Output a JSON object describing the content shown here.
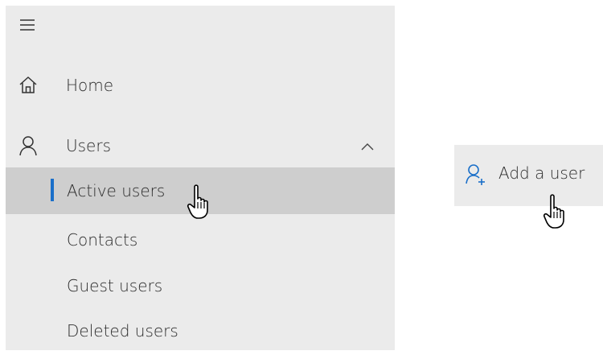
{
  "nav": {
    "menu_icon": "hamburger-icon",
    "items": [
      {
        "label": "Home",
        "icon": "home-icon"
      },
      {
        "label": "Users",
        "icon": "person-icon",
        "expanded": true,
        "chevron": "chevron-up-icon"
      }
    ],
    "users_submenu": [
      {
        "label": "Active users",
        "selected": true
      },
      {
        "label": "Contacts"
      },
      {
        "label": "Guest users"
      },
      {
        "label": "Deleted users"
      }
    ]
  },
  "add_user": {
    "label": "Add a user",
    "icon": "add-person-icon"
  },
  "colors": {
    "nav_bg": "#ebebeb",
    "selected_bg": "#cecece",
    "accent": "#1a6fc9"
  }
}
